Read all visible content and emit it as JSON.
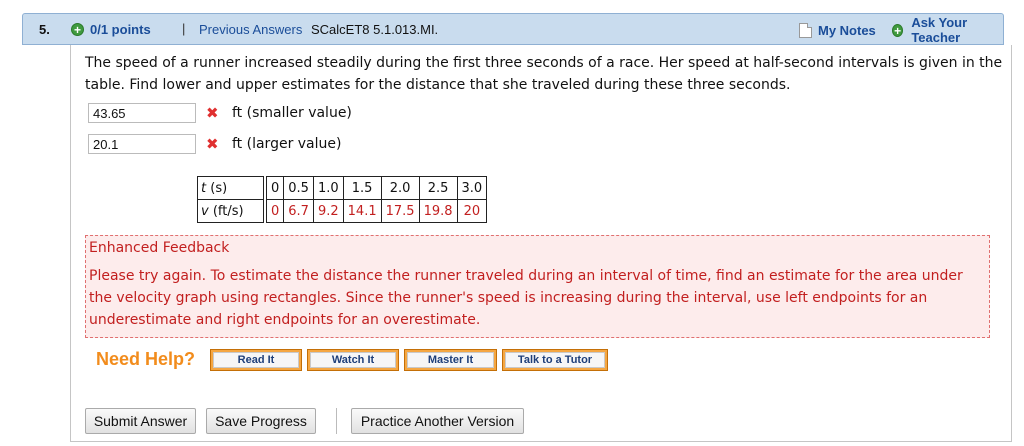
{
  "header": {
    "question_number": "5.",
    "points": "0/1 points",
    "separator": "|",
    "previous_answers": "Previous Answers",
    "problem_code": "SCalcET8 5.1.013.MI.",
    "my_notes": "My Notes",
    "ask_teacher": "Ask Your Teacher"
  },
  "question": {
    "text": "The speed of a runner increased steadily during the first three seconds of a race. Her speed at half-second intervals is given in the table. Find lower and upper estimates for the distance that she traveled during these three seconds."
  },
  "answers": [
    {
      "value": "43.65",
      "label": "ft (smaller value)",
      "status": "incorrect"
    },
    {
      "value": "20.1",
      "label": "ft (larger value)",
      "status": "incorrect"
    }
  ],
  "table": {
    "row_t": {
      "label": "t",
      "unit": "(s)",
      "values": [
        "0",
        "0.5",
        "1.0",
        "1.5",
        "2.0",
        "2.5",
        "3.0"
      ]
    },
    "row_v": {
      "label": "v",
      "unit": "(ft/s)",
      "values": [
        "0",
        "6.7",
        "9.2",
        "14.1",
        "17.5",
        "19.8",
        "20"
      ]
    }
  },
  "feedback": {
    "title": "Enhanced Feedback",
    "body": "Please try again. To estimate the distance the runner traveled during an interval of time, find an estimate for the area under the velocity graph using rectangles. Since the runner's speed is increasing during the interval, use left endpoints for an underestimate and right endpoints for an overestimate."
  },
  "help": {
    "label": "Need Help?",
    "buttons": [
      "Read It",
      "Watch It",
      "Master It",
      "Talk to a Tutor"
    ]
  },
  "actions": {
    "submit": "Submit Answer",
    "save": "Save Progress",
    "practice": "Practice Another Version"
  },
  "colors": {
    "header_bg": "#c9dcee",
    "link": "#1a4d99",
    "error": "#c21f1f",
    "help_orange": "#f28c1c"
  },
  "icons": {
    "points": "plus-circle-icon",
    "notes": "note-page-icon",
    "ask": "plus-circle-icon",
    "incorrect": "x-mark-icon"
  }
}
